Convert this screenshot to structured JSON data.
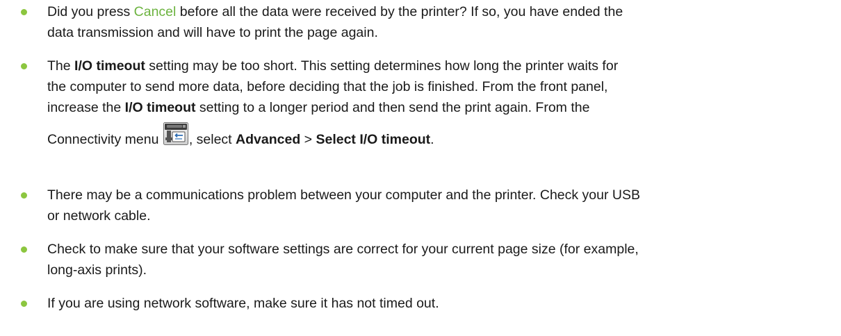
{
  "bullets": [
    {
      "part1": "Did you press ",
      "link": "Cancel",
      "part2": " before all the data were received by the printer? If so, you have ended the",
      "line2": "data transmission and will have to print the page again."
    },
    {
      "l1_a": "The ",
      "l1_b": "I/O timeout",
      "l1_c": " setting may be too short. This setting determines how long the printer waits for",
      "l2": "the computer to send more data, before deciding that the job is finished. From the front panel,",
      "l3_a": "increase the ",
      "l3_b": "I/O timeout",
      "l3_c": " setting to a longer period and then send the print again. From the",
      "l4_a": "Connectivity menu ",
      "l4_b": ", select ",
      "l4_c": "Advanced",
      "l4_d": " > ",
      "l4_e": "Select I/O timeout",
      "l4_f": ".",
      "icon": "connectivity-icon"
    },
    {
      "line1": "There may be a communications problem between your computer and the printer. Check your USB",
      "line2": "or network cable."
    },
    {
      "line1": "Check to make sure that your software settings are correct for your current page size (for example,",
      "line2": "long-axis prints)."
    },
    {
      "line1": "If you are using network software, make sure it has not timed out."
    }
  ],
  "colors": {
    "bullet": "#8cc63f",
    "link": "#6cb33f",
    "text": "#1a1a1a"
  }
}
